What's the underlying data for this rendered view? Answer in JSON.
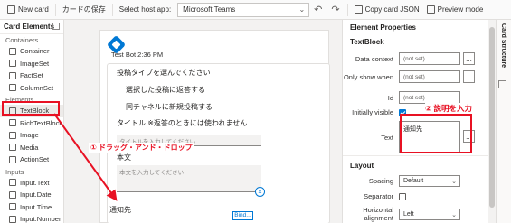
{
  "toolbar": {
    "new_card": "New card",
    "save_card": "カードの保存",
    "host_app_label": "Select host app:",
    "host_app_value": "Microsoft Teams",
    "copy_json": "Copy card JSON",
    "preview_mode": "Preview mode"
  },
  "left_panel": {
    "title": "Card Elements",
    "categories": [
      {
        "name": "Containers",
        "items": [
          "Container",
          "ImageSet",
          "FactSet",
          "ColumnSet"
        ]
      },
      {
        "name": "Elements",
        "items": [
          "TextBlock",
          "RichTextBlock",
          "Image",
          "Media",
          "ActionSet"
        ]
      },
      {
        "name": "Inputs",
        "items": [
          "Input.Text",
          "Input.Date",
          "Input.Time",
          "Input.Number"
        ]
      }
    ],
    "selected_item": "TextBlock"
  },
  "card": {
    "bot_name": "Test Bot 2:36 PM",
    "lines": [
      "投稿タイプを選んでください",
      "選択した投稿に返答する",
      "同チャネルに新規投稿する",
      "タイトル ※返答のときには使われません"
    ],
    "title_placeholder": "タイトルを入力してください",
    "body_label": "本文",
    "body_placeholder": "本文を入力してください",
    "dropped_text": "通知先",
    "bind_label": "Bind...",
    "close_glyph": "×"
  },
  "annotations": {
    "step1": "① ドラッグ・アンド・ドロップ",
    "step2": "② 説明を入力",
    "color": "#e81123"
  },
  "right_panel": {
    "title": "Element Properties",
    "element_type": "TextBlock",
    "fields": {
      "data_context": {
        "label": "Data context",
        "value": "(not set)"
      },
      "only_show_when": {
        "label": "Only show when",
        "value": "(not set)"
      },
      "id": {
        "label": "Id",
        "value": "(not set)"
      },
      "initially_visible": {
        "label": "Initially visible",
        "checked": true
      },
      "text": {
        "label": "Text",
        "value": "通知先"
      }
    },
    "more_glyph": "...",
    "layout_section": "Layout",
    "spacing": {
      "label": "Spacing",
      "value": "Default"
    },
    "separator": {
      "label": "Separator",
      "checked": false
    },
    "horizontal_alignment": {
      "label": "Horizontal alignment",
      "value": "Left"
    }
  },
  "vertical_tab": "Card Structure",
  "colors": {
    "accent": "#0078d4",
    "annotation": "#e81123"
  }
}
